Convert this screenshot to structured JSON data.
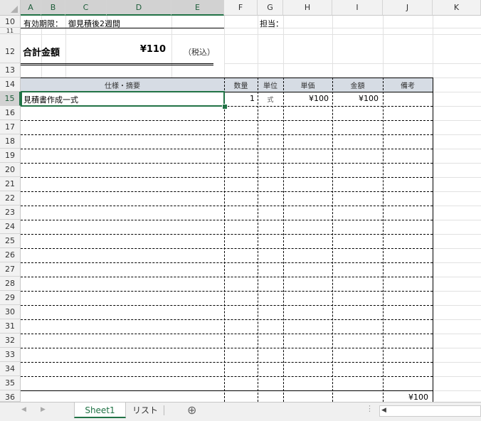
{
  "columns": [
    "A",
    "B",
    "C",
    "D",
    "E",
    "F",
    "G",
    "H",
    "I",
    "J",
    "K"
  ],
  "rows": [
    "10",
    "11",
    "12",
    "13",
    "14",
    "15",
    "16",
    "17",
    "18",
    "19",
    "20",
    "21",
    "22",
    "23",
    "24",
    "25",
    "26",
    "27",
    "28",
    "29",
    "30",
    "31",
    "32",
    "33",
    "34",
    "35",
    "36"
  ],
  "header": {
    "validity_label": "有効期限：",
    "validity_value": "御見積後2週間",
    "staff_label": "担当：",
    "total_label": "合計金額",
    "total_value": "¥110",
    "tax_note": "（税込）"
  },
  "table": {
    "headers": {
      "spec": "仕様・摘要",
      "qty": "数量",
      "unit": "単位",
      "price": "単価",
      "amount": "金額",
      "note": "備考"
    },
    "rows": [
      {
        "spec": "見積書作成一式",
        "qty": "1",
        "unit": "式",
        "price": "¥100",
        "amount": "¥100",
        "note": ""
      }
    ],
    "footer_total": "¥100"
  },
  "tabs": {
    "sheet1": "Sheet1",
    "list": "リスト",
    "add_symbol": "⊕"
  },
  "colors": {
    "accent": "#217346",
    "header_fill": "#d6dce4"
  }
}
